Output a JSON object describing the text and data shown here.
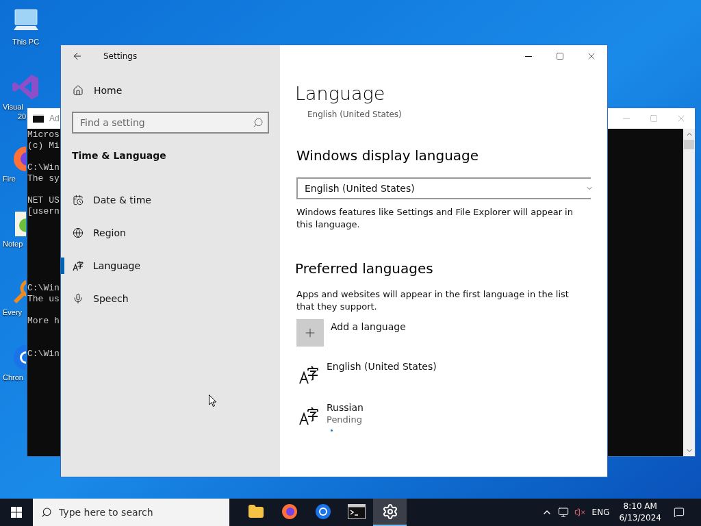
{
  "desktop_icons": [
    {
      "kind": "pc",
      "lines": [
        "This PC"
      ]
    },
    {
      "kind": "vs",
      "lines": [
        "Visual",
        "20"
      ]
    },
    {
      "kind": "firefox",
      "lines": [
        "Fire"
      ]
    },
    {
      "kind": "notepad",
      "lines": [
        "Notep"
      ]
    },
    {
      "kind": "everything",
      "lines": [
        "Every"
      ]
    },
    {
      "kind": "chrome",
      "lines": [
        "Chron"
      ]
    }
  ],
  "console_window": {
    "title": "Ad",
    "blocks": [
      [
        "Micros",
        "(c) Mi"
      ],
      [
        "C:\\Win",
        "The sy"
      ],
      [
        "NET US",
        "[usern"
      ],
      [
        "C:\\Win",
        "The us"
      ],
      [
        "More h"
      ],
      [
        "C:\\Win"
      ]
    ]
  },
  "settings_window": {
    "title": "Settings",
    "home": "Home",
    "search": {
      "placeholder": "Find a setting"
    },
    "section": "Time & Language",
    "nav": [
      {
        "kind": "calendar",
        "label": "Date & time",
        "selected": false
      },
      {
        "kind": "globe",
        "label": "Region",
        "selected": false
      },
      {
        "kind": "language",
        "label": "Language",
        "selected": true
      },
      {
        "kind": "mic",
        "label": "Speech",
        "selected": false
      }
    ],
    "page": {
      "title": "Language",
      "current": "English (United States)",
      "display_heading": "Windows display language",
      "display_select": "English (United States)",
      "display_note": "Windows features like Settings and File Explorer will appear in this language.",
      "preferred_heading": "Preferred languages",
      "preferred_note": "Apps and websites will appear in the first language in the list that they support.",
      "add_label": "Add a language",
      "languages": [
        {
          "name": "English (United States)"
        },
        {
          "name": "Russian",
          "status": "Pending"
        }
      ]
    }
  },
  "taskbar": {
    "search_placeholder": "Type here to search",
    "apps": [
      {
        "kind": "explorer",
        "active": false
      },
      {
        "kind": "firefox",
        "active": false
      },
      {
        "kind": "chrome",
        "active": false
      },
      {
        "kind": "console",
        "active": false
      },
      {
        "kind": "settings",
        "active": true
      }
    ],
    "tray": {
      "language": "ENG",
      "time": "8:10 AM",
      "date": "6/13/2024"
    }
  }
}
